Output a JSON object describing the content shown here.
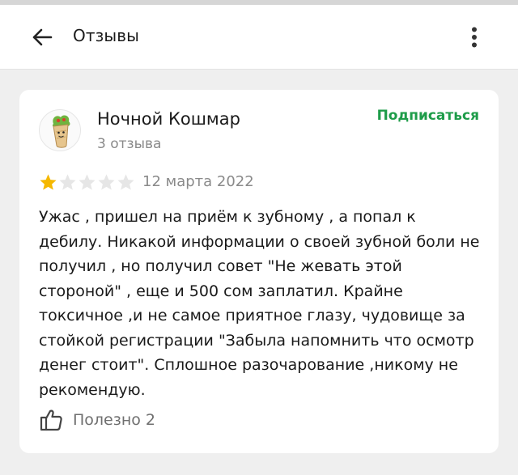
{
  "header": {
    "title": "Отзывы",
    "back_icon": "arrow-left-icon",
    "more_icon": "more-vertical-icon"
  },
  "review": {
    "author": {
      "name": "Ночной Кошмар",
      "reviews_count": "3 отзыва",
      "avatar_icon": "shawarma-avatar"
    },
    "subscribe_label": "Подписаться",
    "rating": 1,
    "rating_max": 5,
    "date": "12 марта 2022",
    "text": "Ужас , пришел на приём к зубному , а попал к дебилу. Никакой информации о своей зубной боли не получил , но получил совет \"Не жевать этой стороной\" , еще и 500 сом заплатил. Крайне токсичное ,и не самое приятное глазу, чудовище за стойкой регистрации \"Забыла напомнить что осмотр денег стоит\". Сплошное разочарование ,никому не рекомендую.",
    "helpful": {
      "label": "Полезно",
      "count": "2",
      "icon": "thumbs-up-icon"
    }
  },
  "colors": {
    "background": "#efefef",
    "card": "#ffffff",
    "accent_green": "#1e9c49",
    "star_filled": "#f5b800",
    "star_empty": "#e6e6e6",
    "secondary_text": "#8a8a8a"
  }
}
